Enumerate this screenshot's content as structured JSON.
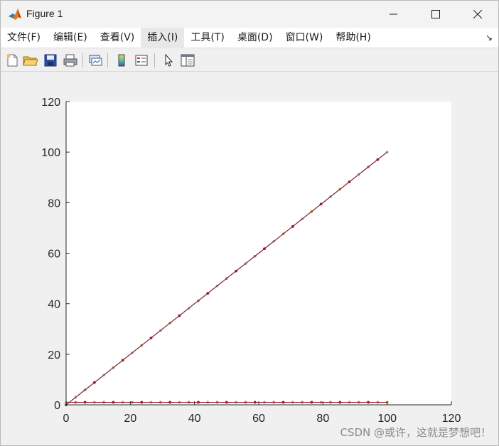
{
  "window": {
    "title": "Figure 1",
    "controls": {
      "minimize": "minimize",
      "maximize": "maximize",
      "close": "close"
    }
  },
  "menu": {
    "items": [
      {
        "label": "文件(F)"
      },
      {
        "label": "编辑(E)"
      },
      {
        "label": "查看(V)"
      },
      {
        "label": "插入(I)"
      },
      {
        "label": "工具(T)"
      },
      {
        "label": "桌面(D)"
      },
      {
        "label": "窗口(W)"
      },
      {
        "label": "帮助(H)"
      }
    ],
    "overflow_icon": "dock-arrow-icon"
  },
  "toolbar": {
    "buttons": [
      {
        "icon": "new-figure-icon"
      },
      {
        "icon": "open-folder-icon"
      },
      {
        "icon": "save-icon"
      },
      {
        "icon": "print-icon"
      },
      {
        "icon": "link-plot-icon"
      },
      {
        "icon": "colorbar-icon"
      },
      {
        "icon": "legend-icon"
      },
      {
        "icon": "pointer-icon"
      },
      {
        "icon": "property-editor-icon"
      }
    ]
  },
  "chart_data": {
    "type": "line",
    "title": "",
    "xlabel": "",
    "ylabel": "",
    "xlim": [
      0,
      120
    ],
    "ylim": [
      0,
      120
    ],
    "xticks": [
      "0",
      "20",
      "40",
      "60",
      "80",
      "100",
      "120"
    ],
    "yticks": [
      "0",
      "20",
      "40",
      "60",
      "80",
      "100",
      "120"
    ],
    "grid": false,
    "series": [
      {
        "color": "#0072bd",
        "x": [
          0,
          100
        ],
        "y": [
          0,
          100
        ]
      },
      {
        "color": "#d95319",
        "x": [
          0,
          100
        ],
        "y": [
          0,
          100
        ]
      },
      {
        "color": "#edb120",
        "x": [
          0,
          100
        ],
        "y": [
          0,
          100
        ]
      },
      {
        "color": "#7e2f8e",
        "x": [
          0,
          100
        ],
        "y": [
          0,
          100
        ]
      },
      {
        "color": "#77ac30",
        "x": [
          0,
          100
        ],
        "y": [
          0,
          100
        ]
      },
      {
        "color": "#4dbeee",
        "x": [
          0,
          100
        ],
        "y": [
          0,
          100
        ]
      },
      {
        "color": "#a2142f",
        "x": [
          0,
          100
        ],
        "y": [
          0,
          100
        ]
      },
      {
        "color": "#0072bd",
        "x": [
          0,
          100
        ],
        "y": [
          1,
          1
        ]
      },
      {
        "color": "#d95319",
        "x": [
          0,
          100
        ],
        "y": [
          1,
          1
        ]
      },
      {
        "color": "#edb120",
        "x": [
          0,
          100
        ],
        "y": [
          1,
          1
        ]
      },
      {
        "color": "#7e2f8e",
        "x": [
          0,
          100
        ],
        "y": [
          1,
          1
        ]
      },
      {
        "color": "#77ac30",
        "x": [
          0,
          100
        ],
        "y": [
          1,
          1
        ]
      },
      {
        "color": "#4dbeee",
        "x": [
          0,
          100
        ],
        "y": [
          1,
          1
        ]
      },
      {
        "color": "#a2142f",
        "x": [
          0,
          100
        ],
        "y": [
          1,
          1
        ]
      }
    ]
  },
  "watermark": "CSDN @或许，这就是梦想吧！"
}
